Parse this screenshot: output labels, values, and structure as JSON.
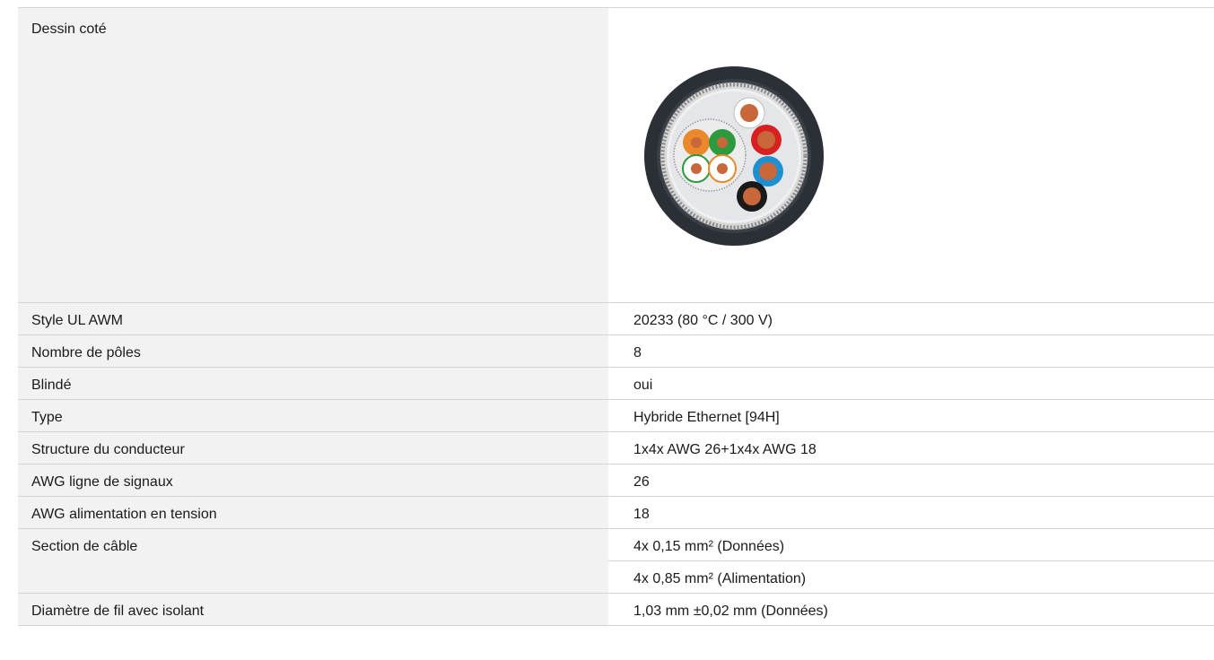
{
  "drawing": {
    "label": "Dessin coté",
    "image_icon": "cable-cross-section-icon"
  },
  "specs": [
    {
      "label": "Style UL AWM",
      "value": "20233 (80 °C / 300 V)"
    },
    {
      "label": "Nombre de pôles",
      "value": "8"
    },
    {
      "label": "Blindé",
      "value": "oui"
    },
    {
      "label": "Type",
      "value": "Hybride Ethernet [94H]"
    },
    {
      "label": "Structure du conducteur",
      "value": "1x4x AWG 26+1x4x AWG 18"
    },
    {
      "label": "AWG ligne de signaux",
      "value": "26"
    },
    {
      "label": "AWG alimentation en tension",
      "value": "18"
    },
    {
      "label": "Section de câble",
      "value": "4x 0,15 mm² (Données)",
      "value2": "4x 0,85 mm² (Alimentation)"
    },
    {
      "label": "Diamètre de fil avec isolant",
      "value": "1,03 mm ±0,02 mm (Données)"
    }
  ],
  "colors": {
    "label_bg": "#f2f2f2",
    "border": "#d4d4d4",
    "jacket": "#2b2f36",
    "copper": "#c8673a"
  }
}
